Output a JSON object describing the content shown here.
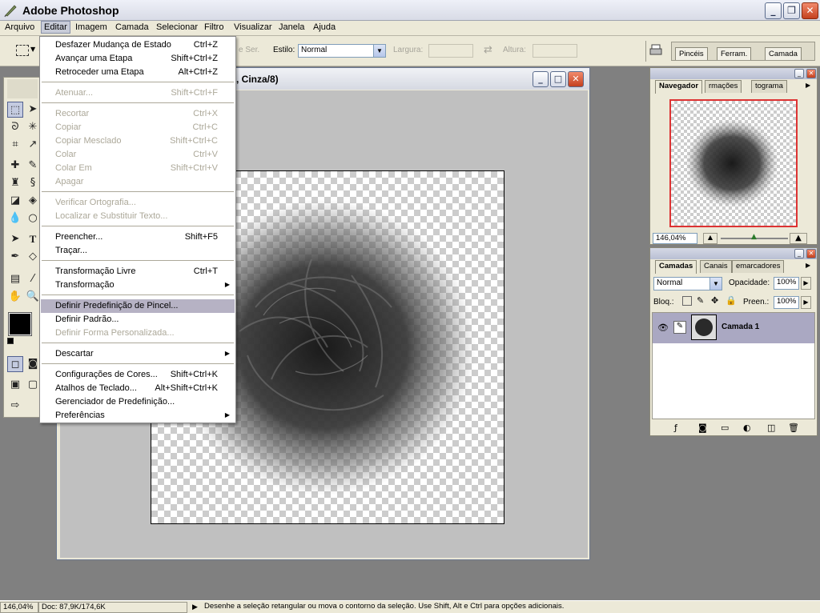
{
  "app": {
    "title": "Adobe Photoshop"
  },
  "menubar": [
    "Arquivo",
    "Editar",
    "Imagem",
    "Camada",
    "Selecionar",
    "Filtro",
    "Visualizar",
    "Janela",
    "Ajuda"
  ],
  "options": {
    "feather_partial": "e Ser.",
    "style_label": "Estilo:",
    "style_value": "Normal",
    "width_label": "Largura:",
    "height_label": "Altura:",
    "palette_tabs": [
      "Pincéis",
      "Ferram.",
      "Camada"
    ]
  },
  "document": {
    "title_partial": ", Cinza/8)"
  },
  "edit_menu": [
    {
      "label": "Desfazer Mudança de Estado",
      "key": "Ctrl+Z"
    },
    {
      "label": "Avançar uma Etapa",
      "key": "Shift+Ctrl+Z"
    },
    {
      "label": "Retroceder uma Etapa",
      "key": "Alt+Ctrl+Z"
    },
    {
      "label": "Atenuar...",
      "key": "Shift+Ctrl+F"
    },
    {
      "label": "Recortar",
      "key": "Ctrl+X"
    },
    {
      "label": "Copiar",
      "key": "Ctrl+C"
    },
    {
      "label": "Copiar Mesclado",
      "key": "Shift+Ctrl+C"
    },
    {
      "label": "Colar",
      "key": "Ctrl+V"
    },
    {
      "label": "Colar Em",
      "key": "Shift+Ctrl+V"
    },
    {
      "label": "Apagar",
      "key": ""
    },
    {
      "label": "Verificar Ortografia...",
      "key": ""
    },
    {
      "label": "Localizar e Substituir Texto...",
      "key": ""
    },
    {
      "label": "Preencher...",
      "key": "Shift+F5"
    },
    {
      "label": "Traçar...",
      "key": ""
    },
    {
      "label": "Transformação Livre",
      "key": "Ctrl+T"
    },
    {
      "label": "Transformação",
      "key": ""
    },
    {
      "label": "Definir Predefinição de Pincel...",
      "key": ""
    },
    {
      "label": "Definir Padrão...",
      "key": ""
    },
    {
      "label": "Definir Forma Personalizada...",
      "key": ""
    },
    {
      "label": "Descartar",
      "key": ""
    },
    {
      "label": "Configurações de Cores...",
      "key": "Shift+Ctrl+K"
    },
    {
      "label": "Atalhos de Teclado...",
      "key": "Alt+Shift+Ctrl+K"
    },
    {
      "label": "Gerenciador de Predefinição...",
      "key": ""
    },
    {
      "label": "Preferências",
      "key": ""
    }
  ],
  "navigator": {
    "tabs": [
      "Navegador",
      "rmações",
      "tograma"
    ],
    "zoom": "146,04%"
  },
  "layers": {
    "tabs": [
      "Camadas",
      "Canais",
      "emarcadores"
    ],
    "blend_mode": "Normal",
    "opacity_label": "Opacidade:",
    "opacity_value": "100%",
    "lock_label": "Bloq.:",
    "fill_label": "Preen.:",
    "fill_value": "100%",
    "layer_name": "Camada 1"
  },
  "status": {
    "zoom": "146,04%",
    "doc": "Doc: 87,9K/174,6K",
    "hint": "Desenhe a seleção retangular ou mova o contorno da seleção. Use Shift, Alt e Ctrl para opções adicionais."
  }
}
